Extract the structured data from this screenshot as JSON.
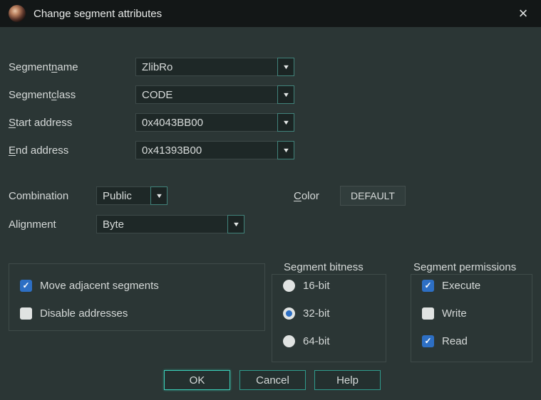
{
  "window": {
    "title": "Change segment attributes",
    "close_glyph": "×"
  },
  "form": {
    "rows": [
      {
        "label_pre": "Segment ",
        "mnemonic": "n",
        "label_post": "ame",
        "value": "ZlibRo"
      },
      {
        "label_pre": "Segment ",
        "mnemonic": "c",
        "label_post": "lass",
        "value": "CODE"
      },
      {
        "label_pre": "",
        "mnemonic": "S",
        "label_post": "tart address",
        "value": "0x4043BB00"
      },
      {
        "label_pre": "",
        "mnemonic": "E",
        "label_post": "nd address",
        "value": "0x41393B00"
      }
    ],
    "combination": {
      "label": "Combination",
      "value": "Public"
    },
    "color": {
      "label_pre": "",
      "mnemonic": "C",
      "label_post": "olor",
      "button": "DEFAULT"
    },
    "alignment": {
      "label": "Alignment",
      "value": "Byte"
    }
  },
  "groups": {
    "options": {
      "items": [
        {
          "label": "Move adjacent segments",
          "checked": true
        },
        {
          "label": "Disable addresses",
          "checked": false
        }
      ]
    },
    "bitness": {
      "title": "Segment bitness",
      "options": [
        {
          "label": "16-bit",
          "selected": false
        },
        {
          "label": "32-bit",
          "selected": true
        },
        {
          "label": "64-bit",
          "selected": false
        }
      ]
    },
    "permissions": {
      "title": "Segment permissions",
      "items": [
        {
          "label": "Execute",
          "checked": true
        },
        {
          "label": "Write",
          "checked": false
        },
        {
          "label": "Read",
          "checked": true
        }
      ]
    }
  },
  "buttons": {
    "ok": "OK",
    "cancel": "Cancel",
    "help": "Help"
  },
  "glyphs": {
    "dropdown": "▼",
    "check": "✓"
  },
  "colors": {
    "dialog_bg": "#2b3635",
    "titlebar_bg": "#131717",
    "input_bg": "#1e2827",
    "accent_teal": "#3ad0b9",
    "checkbox_blue": "#2d6fc4"
  }
}
